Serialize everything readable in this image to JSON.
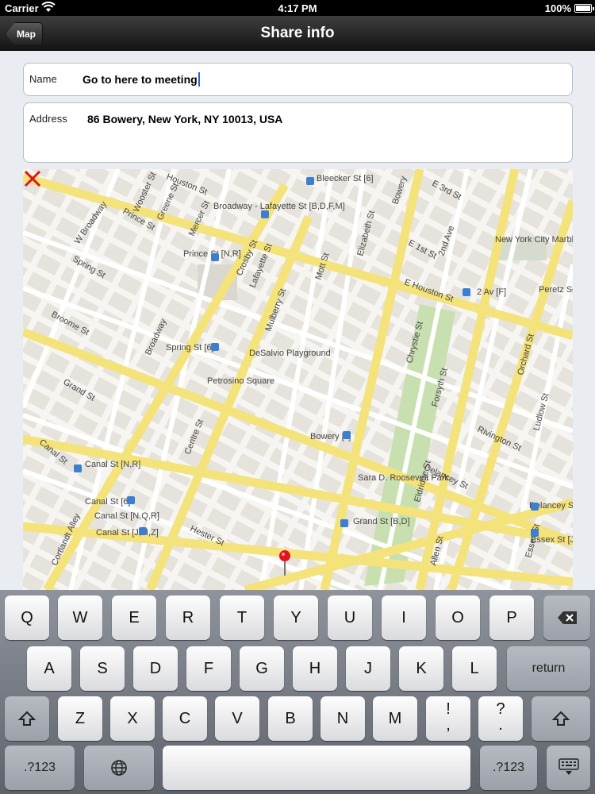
{
  "status_bar": {
    "carrier": "Carrier",
    "time": "4:17 PM",
    "battery": "100%"
  },
  "nav": {
    "back_label": "Map",
    "title": "Share info"
  },
  "form": {
    "name_label": "Name",
    "name_value": "Go to here to meeting",
    "address_label": "Address",
    "address_value": "86 Bowery, New York, NY 10013, USA"
  },
  "map": {
    "streets": [
      "Houston St",
      "Broadway - Lafayette St [B,D,F,M]",
      "Bleecker St [6]",
      "E 3rd St",
      "E 1st St",
      "2nd Ave",
      "Bowery",
      "Wooster St",
      "Prince St",
      "Greene St",
      "W Broadway",
      "Mercer St",
      "Crosby St",
      "Lafayette St",
      "Elizabeth St",
      "Mott St",
      "Mulberry St",
      "Prince St [N,R]",
      "Spring St",
      "Broome St",
      "Broadway",
      "Spring St [6]",
      "DeSalvio Playground",
      "Petrosino Square",
      "Grand St",
      "Centre St",
      "Canal St",
      "Canal St [N,R]",
      "Canal St [6]",
      "Canal St [N,Q,R]",
      "Canal St [J,M,Z]",
      "Cortlandt Alley",
      "Hester St",
      "Bowery [J]",
      "Chrystie St",
      "Forsyth St",
      "Eldridge St",
      "Allen St",
      "Orchard St",
      "Ludlow St",
      "Essex St",
      "Rivington St",
      "Delancey St",
      "Sara D. Roosevelt Park",
      "Grand St [B,D]",
      "Delancey St [F]",
      "Essex St [J,M]",
      "2 Av [F]",
      "E Houston St",
      "Peretz Square",
      "New York City Marble Cemetery"
    ],
    "pin_color": "#e0141e"
  },
  "keyboard": {
    "row1": [
      "Q",
      "W",
      "E",
      "R",
      "T",
      "Y",
      "U",
      "I",
      "O",
      "P"
    ],
    "row2": [
      "A",
      "S",
      "D",
      "F",
      "G",
      "H",
      "J",
      "K",
      "L"
    ],
    "row3": [
      "Z",
      "X",
      "C",
      "V",
      "B",
      "N",
      "M"
    ],
    "return_label": "return",
    "numbers_label": ".?123",
    "excl_top": "!",
    "excl_bottom": ",",
    "quest_top": "?",
    "quest_bottom": "."
  }
}
